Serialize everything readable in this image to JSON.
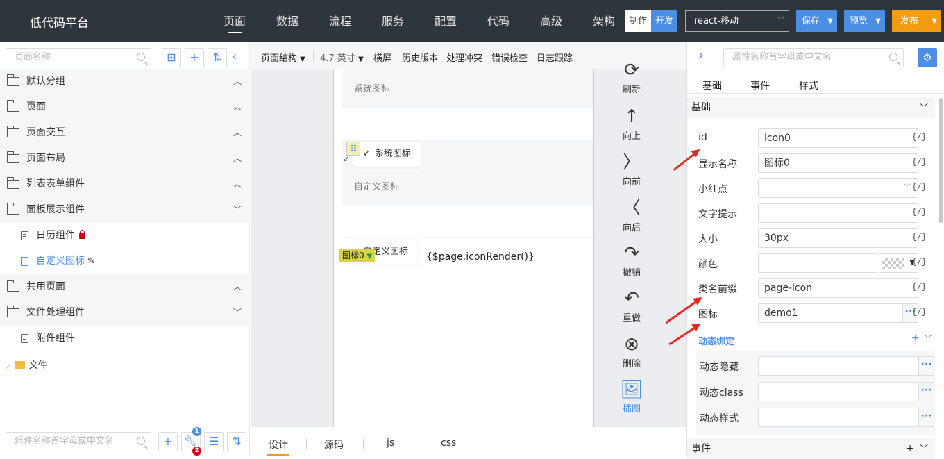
{
  "header": {
    "brand": "低代码平台",
    "nav": [
      "页面",
      "数据",
      "流程",
      "服务",
      "配置",
      "代码",
      "高级",
      "架构"
    ],
    "mode_make": "制作",
    "mode_dev": "开发",
    "device": "react-移动",
    "save": "保存",
    "preview": "预览",
    "publish": "发布"
  },
  "left": {
    "search_placeholder": "页面名称",
    "groups": [
      {
        "label": "默认分组",
        "arrow": "︿"
      },
      {
        "label": "页面",
        "arrow": "︿"
      },
      {
        "label": "页面交互",
        "arrow": "︿"
      },
      {
        "label": "页面布局",
        "arrow": "︿"
      },
      {
        "label": "列表表单组件",
        "arrow": "︿"
      },
      {
        "label": "面板展示组件",
        "arrow": "﹀"
      }
    ],
    "panel_items": [
      {
        "label": "日历组件"
      },
      {
        "label": "自定义图标"
      }
    ],
    "groups2": [
      {
        "label": "共用页面",
        "arrow": "︿"
      },
      {
        "label": "文件处理组件",
        "arrow": "﹀"
      }
    ],
    "file_items": [
      {
        "label": "附件组件"
      }
    ],
    "file_root": "文件",
    "comp_search_placeholder": "组件名称首字母或中文名",
    "badge1": "1",
    "badge2": "2"
  },
  "toolbar": {
    "structure": "页面结构",
    "size": "4.7 英寸",
    "landscape": "横屏",
    "history": "历史版本",
    "conflict": "处理冲突",
    "errors": "错误检查",
    "log": "日志跟踪"
  },
  "canvas": {
    "label_system": "系统图标",
    "card_system": "系统图标",
    "label_custom": "自定义图标",
    "card_custom": "自定义图标",
    "tag_icon": "图标0",
    "expr": "{$page.iconRender()}"
  },
  "sidetools": [
    "刷新",
    "向上",
    "向前",
    "向后",
    "撤销",
    "重做",
    "删除",
    "插图"
  ],
  "bottom_tabs": [
    "设计",
    "源码",
    "js",
    "css"
  ],
  "right": {
    "search_placeholder": "属性名称首字母或中文名",
    "tabs": [
      "基础",
      "事件",
      "样式"
    ],
    "section_basic": "基础",
    "props": [
      {
        "label": "id",
        "value": "icon0"
      },
      {
        "label": "显示名称",
        "value": "图标0"
      },
      {
        "label": "小红点",
        "value": ""
      },
      {
        "label": "文字提示",
        "value": ""
      },
      {
        "label": "大小",
        "value": "30px"
      },
      {
        "label": "颜色",
        "value": ""
      },
      {
        "label": "类名前缀",
        "value": "page-icon"
      },
      {
        "label": "图标",
        "value": "demo1"
      }
    ],
    "bind_token": "{/}",
    "dynamic_title": "动态绑定",
    "dynamic": [
      {
        "label": "动态隐藏"
      },
      {
        "label": "动态class"
      },
      {
        "label": "动态样式"
      }
    ],
    "section_events": "事件"
  }
}
